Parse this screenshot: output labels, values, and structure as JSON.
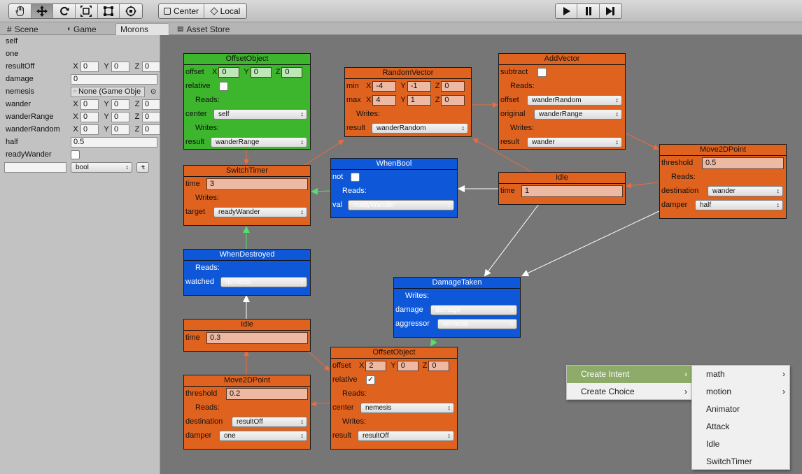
{
  "toolbar": {
    "tools": [
      "hand-icon",
      "move-icon",
      "rotate-icon",
      "scale-icon",
      "rect-icon",
      "transform-icon"
    ],
    "pivot_label": "Center",
    "space_label": "Local"
  },
  "tabs": [
    {
      "label": "Scene",
      "icon": "grid-icon"
    },
    {
      "label": "Game",
      "icon": "pacman-icon"
    },
    {
      "label": "Morons",
      "active": true
    },
    {
      "label": "Asset Store",
      "icon": "store-icon"
    }
  ],
  "inspector": {
    "rows": [
      {
        "label": "self"
      },
      {
        "label": "one"
      },
      {
        "label": "resultOff",
        "x": "0",
        "y": "0",
        "z": "0"
      },
      {
        "label": "damage",
        "value": "0"
      },
      {
        "label": "nemesis",
        "object": "None (Game Obje"
      },
      {
        "label": "wander",
        "x": "0",
        "y": "0",
        "z": "0"
      },
      {
        "label": "wanderRange",
        "x": "0",
        "y": "0",
        "z": "0"
      },
      {
        "label": "wanderRandom",
        "x": "0",
        "y": "0",
        "z": "0"
      },
      {
        "label": "half",
        "value": "0.5"
      },
      {
        "label": "readyWander"
      }
    ],
    "new_var_type": "bool",
    "add_label": "+",
    "axis_x": "X",
    "axis_y": "Y",
    "axis_z": "Z"
  },
  "labels": {
    "reads": "Reads:",
    "writes": "Writes:"
  },
  "nodes": {
    "offsetObject1": {
      "title": "OffsetObject",
      "offset_label": "offset",
      "x": "0",
      "y": "0",
      "z": "0",
      "relative_label": "relative",
      "center_label": "center",
      "center": "self",
      "result_label": "result",
      "result": "wanderRange"
    },
    "randomVector": {
      "title": "RandomVector",
      "min_label": "min",
      "min_x": "-4",
      "min_y": "-1",
      "min_z": "0",
      "max_label": "max",
      "max_x": "4",
      "max_y": "1",
      "max_z": "0",
      "result_label": "result",
      "result": "wanderRandom"
    },
    "addVector": {
      "title": "AddVector",
      "subtract_label": "subtract",
      "offset_label": "offset",
      "offset": "wanderRandom",
      "original_label": "original",
      "original": "wanderRange",
      "result_label": "result",
      "result": "wander"
    },
    "switchTimer": {
      "title": "SwitchTimer",
      "time_label": "time",
      "time": "3",
      "target_label": "target",
      "target": "readyWander"
    },
    "whenBool": {
      "title": "WhenBool",
      "not_label": "not",
      "val_label": "val",
      "val": "readyWander"
    },
    "idle1": {
      "title": "Idle",
      "time_label": "time",
      "time": "1"
    },
    "move2d1": {
      "title": "Move2DPoint",
      "threshold_label": "threshold",
      "threshold": "0.5",
      "destination_label": "destination",
      "destination": "wander",
      "damper_label": "damper",
      "damper": "half"
    },
    "whenDestroyed": {
      "title": "WhenDestroyed",
      "watched_label": "watched",
      "watched": "nemesis"
    },
    "damageTaken": {
      "title": "DamageTaken",
      "damage_label": "damage",
      "damage": "damage",
      "aggressor_label": "aggressor",
      "aggressor": "nemesis"
    },
    "idle2": {
      "title": "Idle",
      "time_label": "time",
      "time": "0.3"
    },
    "offsetObject2": {
      "title": "OffsetObject",
      "offset_label": "offset",
      "x": "2",
      "y": "0",
      "z": "0",
      "relative_label": "relative",
      "relative_checked": "✓",
      "center_label": "center",
      "center": "nemesis",
      "result_label": "result",
      "result": "resultOff"
    },
    "move2d2": {
      "title": "Move2DPoint",
      "threshold_label": "threshold",
      "threshold": "0.2",
      "destination_label": "destination",
      "destination": "resultOff",
      "damper_label": "damper",
      "damper": "one"
    }
  },
  "context_menu": {
    "items": [
      {
        "label": "Create Intent",
        "has_submenu": true,
        "selected": true
      },
      {
        "label": "Create Choice",
        "has_submenu": true
      }
    ],
    "submenu": [
      {
        "label": "math",
        "has_submenu": true
      },
      {
        "label": "motion",
        "has_submenu": true
      },
      {
        "label": "Animator"
      },
      {
        "label": "Attack"
      },
      {
        "label": "Idle"
      },
      {
        "label": "SwitchTimer"
      }
    ],
    "arrow": "›"
  },
  "colors": {
    "intent": "#e0621f",
    "choice": "#0d57d8",
    "root": "#3db52d",
    "canvas": "#767676",
    "wire_orange": "#f06a3c",
    "wire_white": "#ffffff",
    "wire_green": "#54e06a"
  }
}
